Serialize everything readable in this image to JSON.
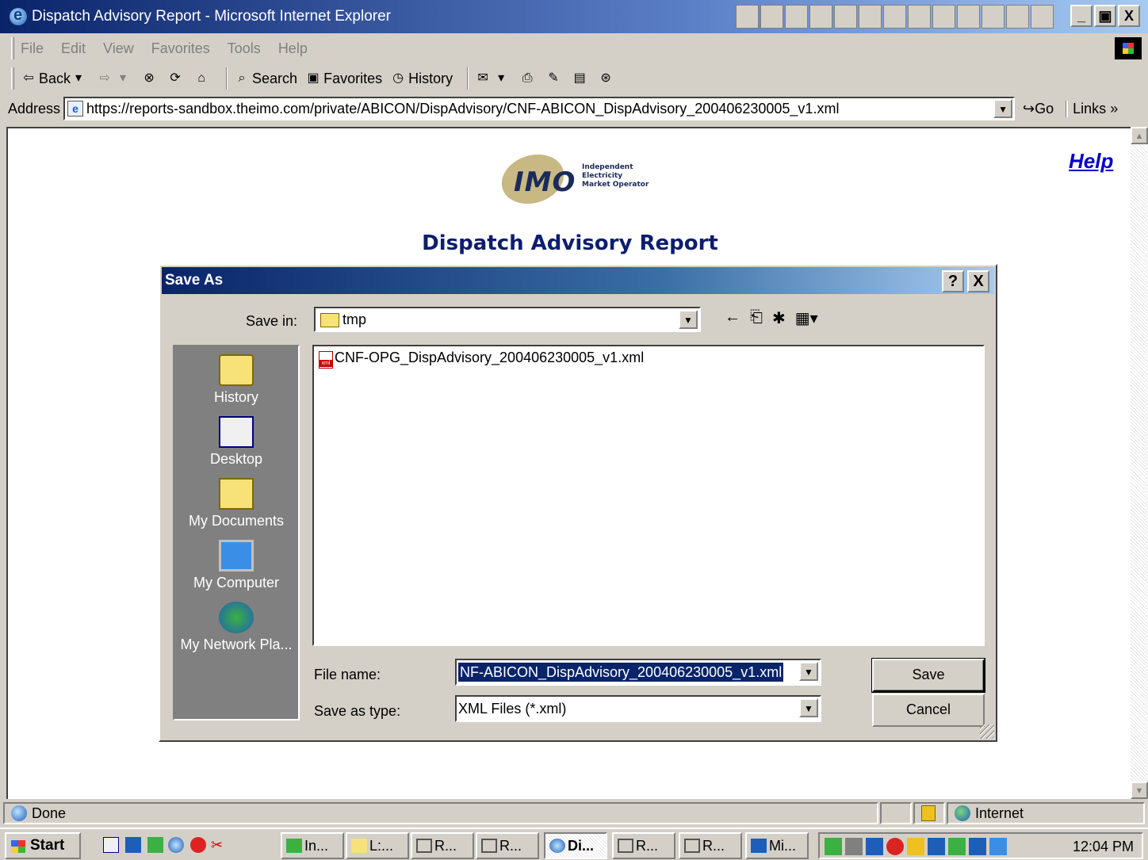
{
  "window": {
    "title": "Dispatch Advisory Report - Microsoft Internet Explorer",
    "controls": [
      "_",
      "▣",
      "X"
    ]
  },
  "menu": [
    "File",
    "Edit",
    "View",
    "Favorites",
    "Tools",
    "Help"
  ],
  "toolbar": {
    "back": "Back",
    "search": "Search",
    "favorites": "Favorites",
    "history": "History"
  },
  "address": {
    "label": "Address",
    "url": "https://reports-sandbox.theimo.com/private/ABICON/DispAdvisory/CNF-ABICON_DispAdvisory_200406230005_v1.xml",
    "go": "Go",
    "links": "Links"
  },
  "page": {
    "logo": {
      "letters": "IMO",
      "line1": "Independent",
      "line2": "Electricity",
      "line3": "Market Operator"
    },
    "help": "Help",
    "title": "Dispatch Advisory Report"
  },
  "dialog": {
    "title": "Save As",
    "help_btn": "?",
    "close_btn": "X",
    "save_in_label": "Save in:",
    "save_in_value": "tmp",
    "places": [
      "History",
      "Desktop",
      "My Documents",
      "My Computer",
      "My Network Pla..."
    ],
    "files": [
      "CNF-OPG_DispAdvisory_200406230005_v1.xml"
    ],
    "file_name_label": "File name:",
    "file_name_value": "NF-ABICON_DispAdvisory_200406230005_v1.xml",
    "save_type_label": "Save as type:",
    "save_type_value": "XML Files (*.xml)",
    "save_button": "Save",
    "cancel_button": "Cancel"
  },
  "status": {
    "text": "Done",
    "zone": "Internet"
  },
  "taskbar": {
    "start": "Start",
    "tasks": [
      "In...",
      "L:...",
      "R...",
      "R...",
      "Di...",
      "R...",
      "R...",
      "Mi..."
    ],
    "active_task": "Di...",
    "clock": "12:04 PM"
  }
}
